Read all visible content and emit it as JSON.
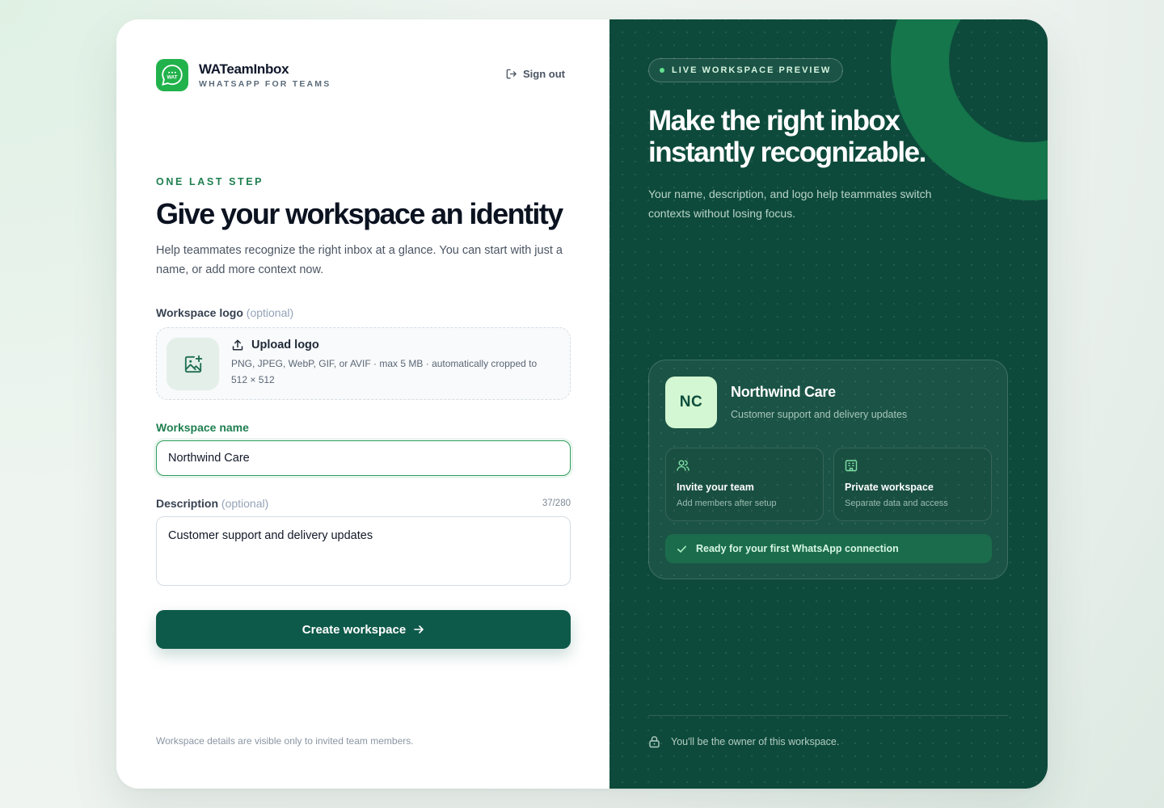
{
  "brand": {
    "logo_text": "WAT",
    "name": "WATeamInbox",
    "tagline": "WHATSAPP FOR TEAMS"
  },
  "header": {
    "sign_out_label": "Sign out"
  },
  "intro": {
    "eyebrow": "ONE LAST STEP",
    "title": "Give your workspace an identity",
    "subtitle": "Help teammates recognize the right inbox at a glance. You can start with just a name, or add more context now."
  },
  "form": {
    "logo": {
      "label": "Workspace logo",
      "optional_label": "(optional)",
      "upload_title": "Upload logo",
      "upload_hint": "PNG, JPEG, WebP, GIF, or AVIF · max 5 MB · automatically cropped to 512 × 512"
    },
    "name": {
      "label": "Workspace name",
      "value": "Northwind Care"
    },
    "description": {
      "label": "Description",
      "optional_label": "(optional)",
      "counter": "37/280",
      "value": "Customer support and delivery updates"
    },
    "submit_label": "Create workspace",
    "footnote": "Workspace details are visible only to invited team members."
  },
  "preview_panel": {
    "badge": "LIVE WORKSPACE PREVIEW",
    "title": "Make the right inbox instantly recognizable.",
    "subtitle": "Your name, description, and logo help teammates switch contexts without losing focus.",
    "card": {
      "initials": "NC",
      "name": "Northwind Care",
      "description": "Customer support and delivery updates",
      "features": [
        {
          "icon": "users-icon",
          "title": "Invite your team",
          "subtitle": "Add members after setup"
        },
        {
          "icon": "building-icon",
          "title": "Private workspace",
          "subtitle": "Separate data and access"
        }
      ],
      "status": "Ready for your first WhatsApp connection"
    },
    "owner_note": "You'll be the owner of this workspace."
  },
  "colors": {
    "accent": "#1e7f4f",
    "primary_button": "#0e5a4a",
    "panel_bg": "#0d4a3b",
    "brand_green": "#22b24c",
    "preview_logo_bg": "#d3f7d2"
  }
}
